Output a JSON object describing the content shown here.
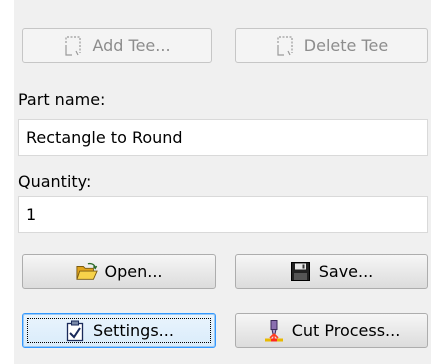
{
  "tee_buttons": {
    "add_label": "Add Tee...",
    "delete_label": "Delete Tee"
  },
  "part_name": {
    "label": "Part name:",
    "value": "Rectangle to Round"
  },
  "quantity": {
    "label": "Quantity:",
    "value": "1"
  },
  "file_buttons": {
    "open_label": "Open...",
    "save_label": "Save..."
  },
  "action_buttons": {
    "settings_label": "Settings...",
    "cut_process_label": "Cut Process..."
  },
  "icons": {
    "add_tee": "tee-bracket-icon",
    "delete_tee": "tee-bracket-icon",
    "open": "open-folder-icon",
    "save": "floppy-disk-icon",
    "settings": "checklist-icon",
    "cut_process": "torch-cut-icon"
  },
  "colors": {
    "window_bg": "#f0f0f0",
    "disabled_text": "#8d8d8d",
    "focus_border": "#3399ff",
    "folder_yellow": "#f2c230"
  }
}
